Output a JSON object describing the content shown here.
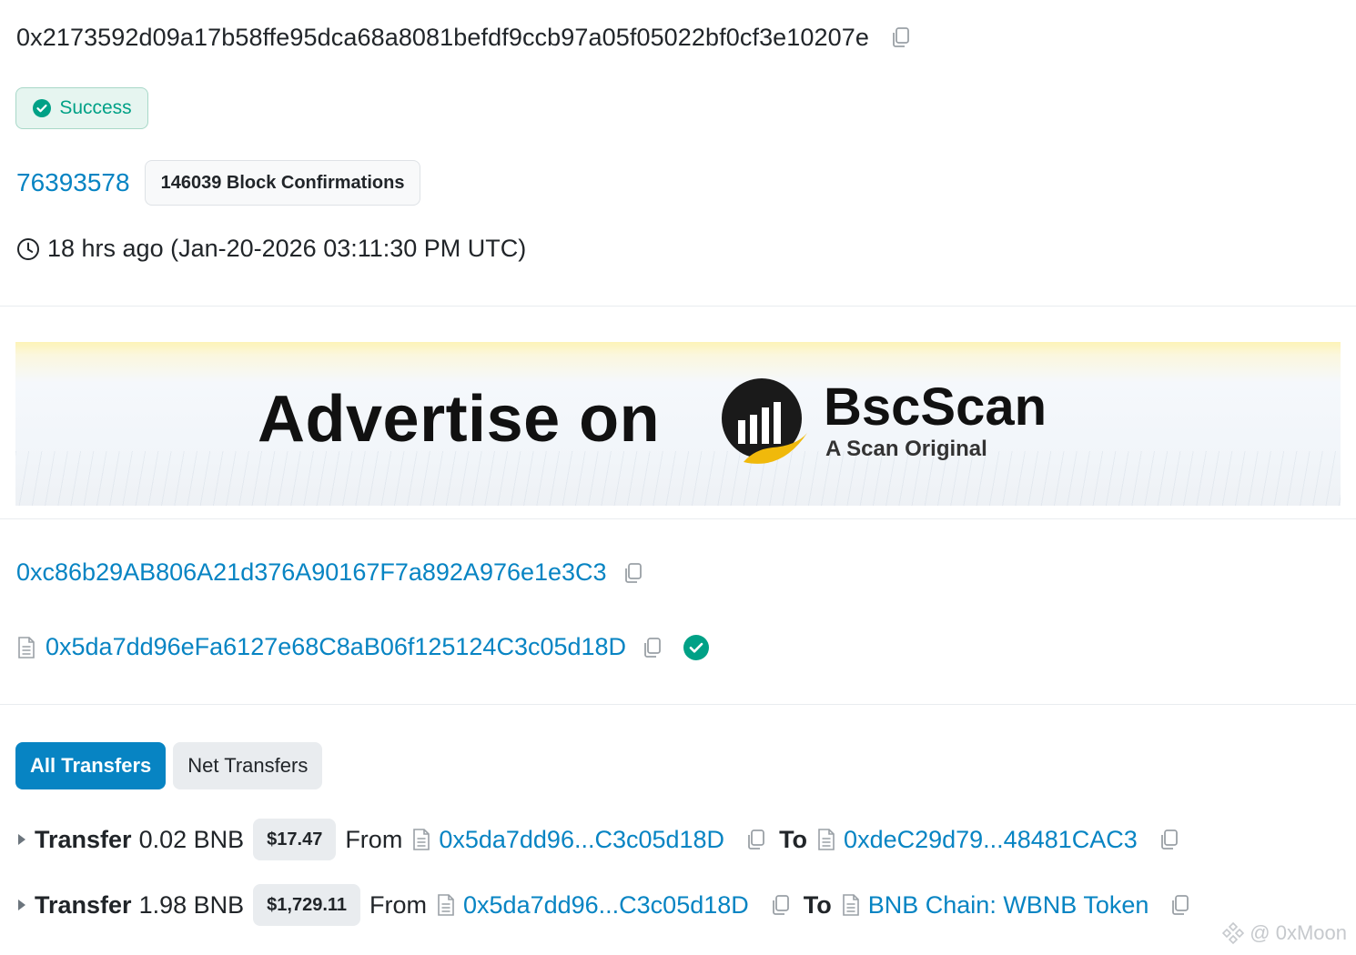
{
  "transaction": {
    "hash": "0x2173592d09a17b58ffe95dca68a8081befdf9ccb97a05f05022bf0cf3e10207e",
    "status": "Success",
    "block_number": "76393578",
    "block_confirmations": "146039 Block Confirmations",
    "timestamp": "18 hrs ago (Jan-20-2026 03:11:30 PM UTC)",
    "from_address": "0xc86b29AB806A21d376A90167F7a892A976e1e3C3",
    "to_address": "0x5da7dd96eFa6127e68C8aB06f125124C3c05d18D"
  },
  "ad": {
    "headline": "Advertise on",
    "brand": "BscScan",
    "tagline": "A Scan Original"
  },
  "tabs": [
    {
      "label": "All Transfers",
      "active": true
    },
    {
      "label": "Net Transfers",
      "active": false
    }
  ],
  "transfers": [
    {
      "label": "Transfer",
      "amount": "0.02 BNB",
      "usd": "$17.47",
      "from_word": "From",
      "from": "0x5da7dd96...C3c05d18D",
      "to_word": "To",
      "to": "0xdeC29d79...48481CAC3"
    },
    {
      "label": "Transfer",
      "amount": "1.98 BNB",
      "usd": "$1,729.11",
      "from_word": "From",
      "from": "0x5da7dd96...C3c05d18D",
      "to_word": "To",
      "to": "BNB Chain: WBNB Token"
    }
  ],
  "watermark": "@ 0xMoon",
  "colors": {
    "link": "#0784c3",
    "success": "#00a186",
    "text": "#212529"
  },
  "icons": [
    "copy-icon",
    "check-circle-icon",
    "clock-icon",
    "contract-file-icon",
    "verified-icon",
    "caret-right-icon"
  ]
}
